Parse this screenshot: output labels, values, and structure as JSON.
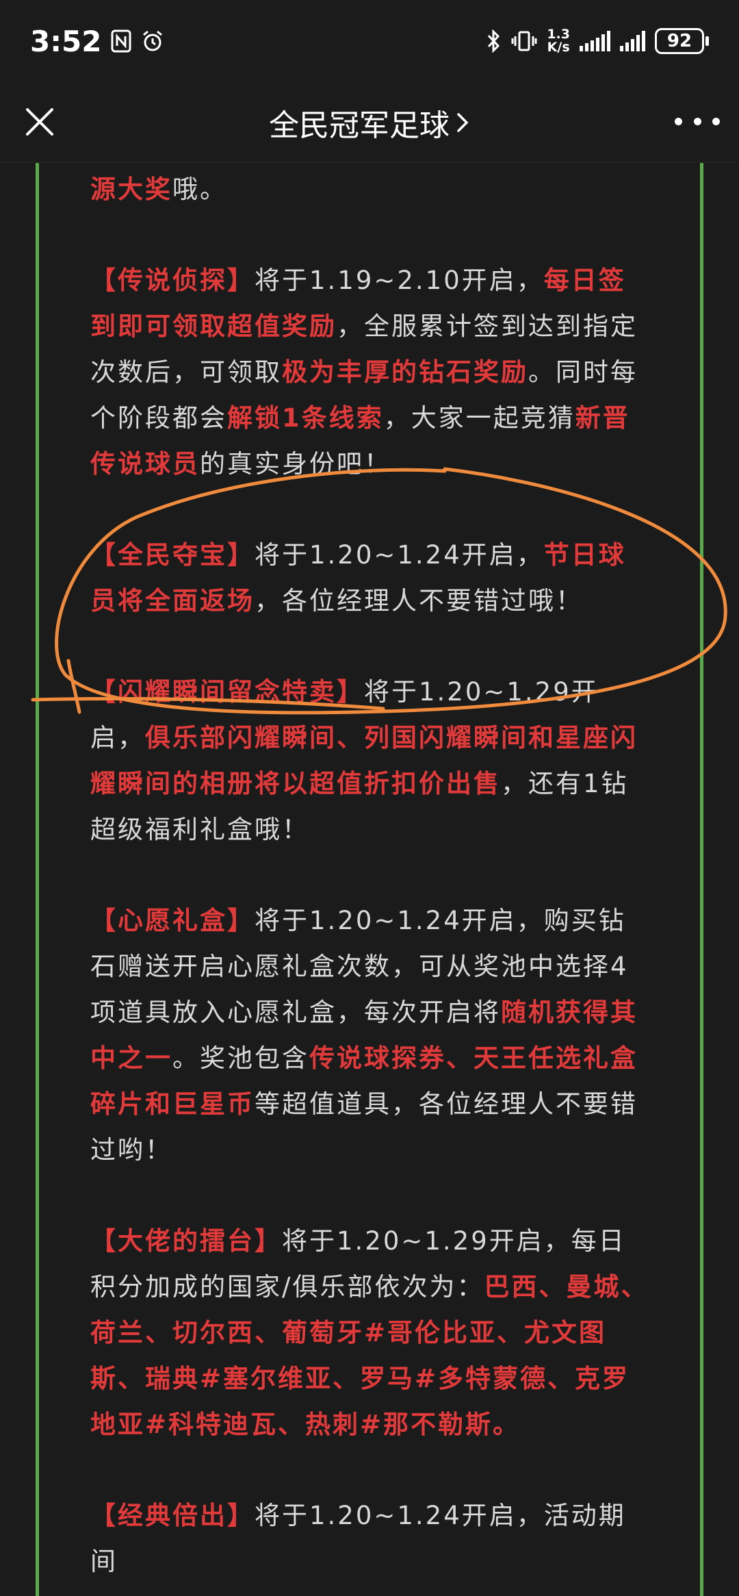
{
  "status": {
    "time": "3:52",
    "net_speed_value": "1.3",
    "net_speed_unit": "K/s",
    "battery": "92"
  },
  "nav": {
    "title": "全民冠军足球",
    "chevron": "›"
  },
  "paragraphs": [
    {
      "segments": [
        {
          "t": "巨星券任选礼盒、殿堂之旅礼盒和其他各种资源大奖",
          "h": true
        },
        {
          "t": "哦。",
          "h": false
        }
      ]
    },
    {
      "segments": [
        {
          "t": "【传说侦探】",
          "h": true
        },
        {
          "t": "将于1.19~2.10开启，",
          "h": false
        },
        {
          "t": "每日签到即可领取超值奖励",
          "h": true
        },
        {
          "t": "，全服累计签到达到指定次数后，可领取",
          "h": false
        },
        {
          "t": "极为丰厚的钻石奖励",
          "h": true
        },
        {
          "t": "。同时每个阶段都会",
          "h": false
        },
        {
          "t": "解锁1条线索",
          "h": true
        },
        {
          "t": "，大家一起竞猜",
          "h": false
        },
        {
          "t": "新晋传说球员",
          "h": true
        },
        {
          "t": "的真实身份吧！",
          "h": false
        }
      ]
    },
    {
      "segments": [
        {
          "t": "【全民夺宝】",
          "h": true
        },
        {
          "t": "将于1.20~1.24开启，",
          "h": false
        },
        {
          "t": "节日球员将全面返场",
          "h": true
        },
        {
          "t": "，各位经理人不要错过哦！",
          "h": false
        }
      ]
    },
    {
      "segments": [
        {
          "t": "【闪耀瞬间留念特卖】",
          "h": true
        },
        {
          "t": "将于1.20~1.29开启，",
          "h": false
        },
        {
          "t": "俱乐部闪耀瞬间、列国闪耀瞬间和星座闪耀瞬间的相册将以超值折扣价出售",
          "h": true
        },
        {
          "t": "，还有1钻超级福利礼盒哦！",
          "h": false
        }
      ]
    },
    {
      "segments": [
        {
          "t": "【心愿礼盒】",
          "h": true
        },
        {
          "t": "将于1.20~1.24开启，购买钻石赠送开启心愿礼盒次数，可从奖池中选择4项道具放入心愿礼盒，每次开启将",
          "h": false
        },
        {
          "t": "随机获得其中之一",
          "h": true
        },
        {
          "t": "。奖池包含",
          "h": false
        },
        {
          "t": "传说球探券、天王任选礼盒碎片和巨星币",
          "h": true
        },
        {
          "t": "等超值道具，各位经理人不要错过哟！",
          "h": false
        }
      ]
    },
    {
      "segments": [
        {
          "t": "【大佬的擂台】",
          "h": true
        },
        {
          "t": "将于1.20~1.29开启，每日积分加成的国家/俱乐部依次为：",
          "h": false
        },
        {
          "t": "巴西、曼城、荷兰、切尔西、葡萄牙#哥伦比亚、尤文图斯、瑞典#塞尔维亚、罗马#多特蒙德、克罗地亚#科特迪瓦、热刺#那不勒斯。",
          "h": true
        }
      ]
    },
    {
      "segments": [
        {
          "t": "【经典倍出】",
          "h": true
        },
        {
          "t": "将于1.20~1.24开启，活动期间",
          "h": false
        }
      ]
    }
  ],
  "colors": {
    "background": "#1b1b1b",
    "highlight": "#e2393b",
    "frame_border": "#5aa94a",
    "annotation": "#f08a3c"
  },
  "icons": [
    "close-icon",
    "more-icon",
    "chevron-right-icon",
    "nfc-icon",
    "alarm-icon",
    "bluetooth-icon",
    "vibrate-icon",
    "signal-icon",
    "battery-icon"
  ]
}
